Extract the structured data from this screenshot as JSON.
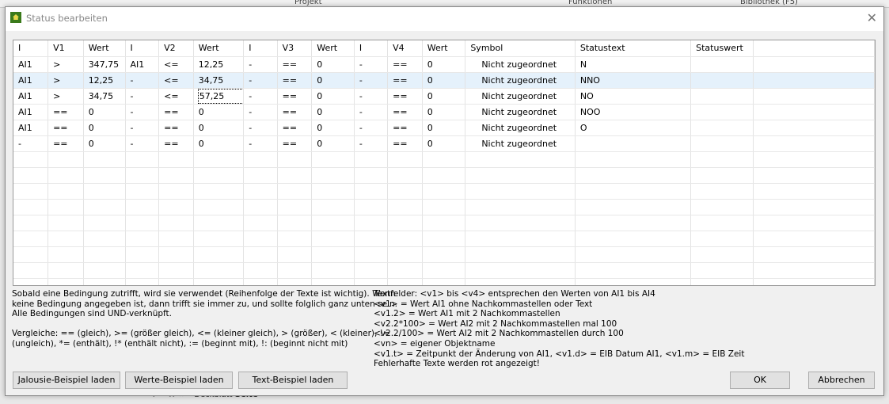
{
  "background": {
    "menu": [
      "Projekt",
      "Funktionen",
      "Bibliothek (F5)"
    ],
    "sheet_tabs": [
      "Deckblatt",
      "Seite"
    ]
  },
  "dialog": {
    "title": "Status bearbeiten"
  },
  "table": {
    "headers": [
      "I",
      "V1",
      "Wert",
      "I",
      "V2",
      "Wert",
      "I",
      "V3",
      "Wert",
      "I",
      "V4",
      "Wert",
      "Symbol",
      "Statustext",
      "Statuswert",
      ""
    ],
    "rows": [
      [
        "AI1",
        ">",
        "347,75",
        "AI1",
        "<=",
        "12,25",
        "-",
        "==",
        "0",
        "-",
        "==",
        "0",
        "Nicht zugeordnet",
        "N",
        ""
      ],
      [
        "AI1",
        ">",
        "12,25",
        "-",
        "<=",
        "34,75",
        "-",
        "==",
        "0",
        "-",
        "==",
        "0",
        "Nicht zugeordnet",
        "NNO",
        ""
      ],
      [
        "AI1",
        ">",
        "34,75",
        "-",
        "<=",
        "57,25",
        "-",
        "==",
        "0",
        "-",
        "==",
        "0",
        "Nicht zugeordnet",
        "NO",
        ""
      ],
      [
        "AI1",
        "==",
        "0",
        "-",
        "==",
        "0",
        "-",
        "==",
        "0",
        "-",
        "==",
        "0",
        "Nicht zugeordnet",
        "NOO",
        ""
      ],
      [
        "AI1",
        "==",
        "0",
        "-",
        "==",
        "0",
        "-",
        "==",
        "0",
        "-",
        "==",
        "0",
        "Nicht zugeordnet",
        "O",
        ""
      ],
      [
        "-",
        "==",
        "0",
        "-",
        "==",
        "0",
        "-",
        "==",
        "0",
        "-",
        "==",
        "0",
        "Nicht zugeordnet",
        "",
        ""
      ]
    ],
    "selected_row": 1
  },
  "help_left": [
    "Sobald eine Bedingung zutrifft, wird sie verwendet (Reihenfolge der Texte ist wichtig). Wenn",
    "keine Bedingung angegeben ist, dann trifft sie immer zu, und sollte folglich ganz unten sein.",
    "Alle Bedingungen sind UND-verknüpft.",
    "",
    "Vergleiche: == (gleich), >= (größer gleich), <= (kleiner gleich), > (größer), < (kleiner), !=",
    "(ungleich), *= (enthält), !* (enthält nicht), := (beginnt mit), !: (beginnt nicht mit)"
  ],
  "help_right": [
    "Textfelder: <v1> bis <v4> entsprechen den Werten von AI1 bis AI4",
    "<v1> = Wert AI1 ohne Nachkommastellen oder Text",
    "<v1.2> = Wert AI1 mit 2 Nachkommastellen",
    "<v2.2*100> = Wert AI2 mit 2 Nachkommastellen mal 100",
    "<v2.2/100> = Wert AI2 mit 2 Nachkommastellen durch 100",
    "<vn> = eigener Objektname",
    "<v1.t> = Zeitpunkt der Änderung von AI1, <v1.d> = EIB Datum AI1, <v1.m> = EIB Zeit",
    "Fehlerhafte Texte werden rot angezeigt!"
  ],
  "buttons": {
    "jalousie": "Jalousie-Beispiel laden",
    "werte": "Werte-Beispiel laden",
    "text": "Text-Beispiel laden",
    "ok": "OK",
    "cancel": "Abbrechen"
  }
}
